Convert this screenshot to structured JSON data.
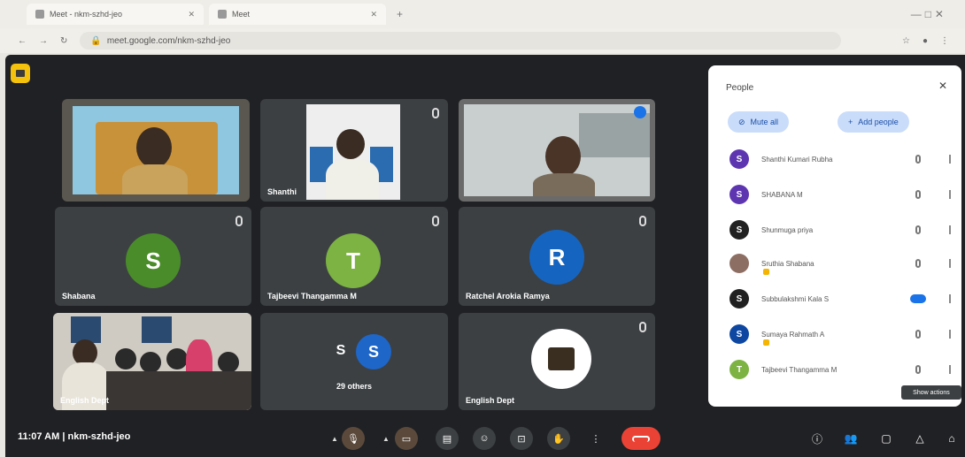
{
  "browser": {
    "tab1_title": "Meet - nkm-szhd-jeo",
    "tab2_title": "Meet",
    "url": "meet.google.com/nkm-szhd-jeo"
  },
  "tiles": [
    {
      "name": "",
      "type": "video"
    },
    {
      "name": "Shanthi",
      "type": "video"
    },
    {
      "name": "",
      "type": "video"
    },
    {
      "name": "Shabana",
      "type": "avatar",
      "initial": "S",
      "color": "#4a8c2a"
    },
    {
      "name": "Tajbeevi Thangamma M",
      "type": "avatar",
      "initial": "T",
      "color": "#7cb342"
    },
    {
      "name": "Ratchel Arokia Ramya",
      "type": "avatar",
      "initial": "R",
      "color": "#1565c0"
    },
    {
      "name": "English Dept",
      "type": "video"
    },
    {
      "name": "29 others",
      "type": "group",
      "initial1": "S",
      "initial2": "S"
    },
    {
      "name": "English Dept",
      "type": "logo"
    }
  ],
  "panel": {
    "title": "People",
    "mute_all": "Mute all",
    "add_people": "Add people",
    "participants": [
      {
        "name": "Shanthi Kumari Rubha",
        "initial": "S",
        "color": "#5e35b1"
      },
      {
        "name": "SHABANA M",
        "initial": "S",
        "color": "#5e35b1"
      },
      {
        "name": "Shunmuga priya",
        "initial": "S",
        "color": "#212121"
      },
      {
        "name": "Sruthia Shabana",
        "initial": "",
        "color": "#8d6e63"
      },
      {
        "name": "Subbulakshmi Kala S",
        "initial": "S",
        "color": "#212121"
      },
      {
        "name": "Sumaya Rahmath A",
        "initial": "S",
        "color": "#0d47a1"
      },
      {
        "name": "Tajbeevi Thangamma M",
        "initial": "T",
        "color": "#7cb342"
      }
    ],
    "tooltip": "Show actions"
  },
  "bottom": {
    "time": "11:07 AM",
    "code": "nkm-szhd-jeo"
  }
}
